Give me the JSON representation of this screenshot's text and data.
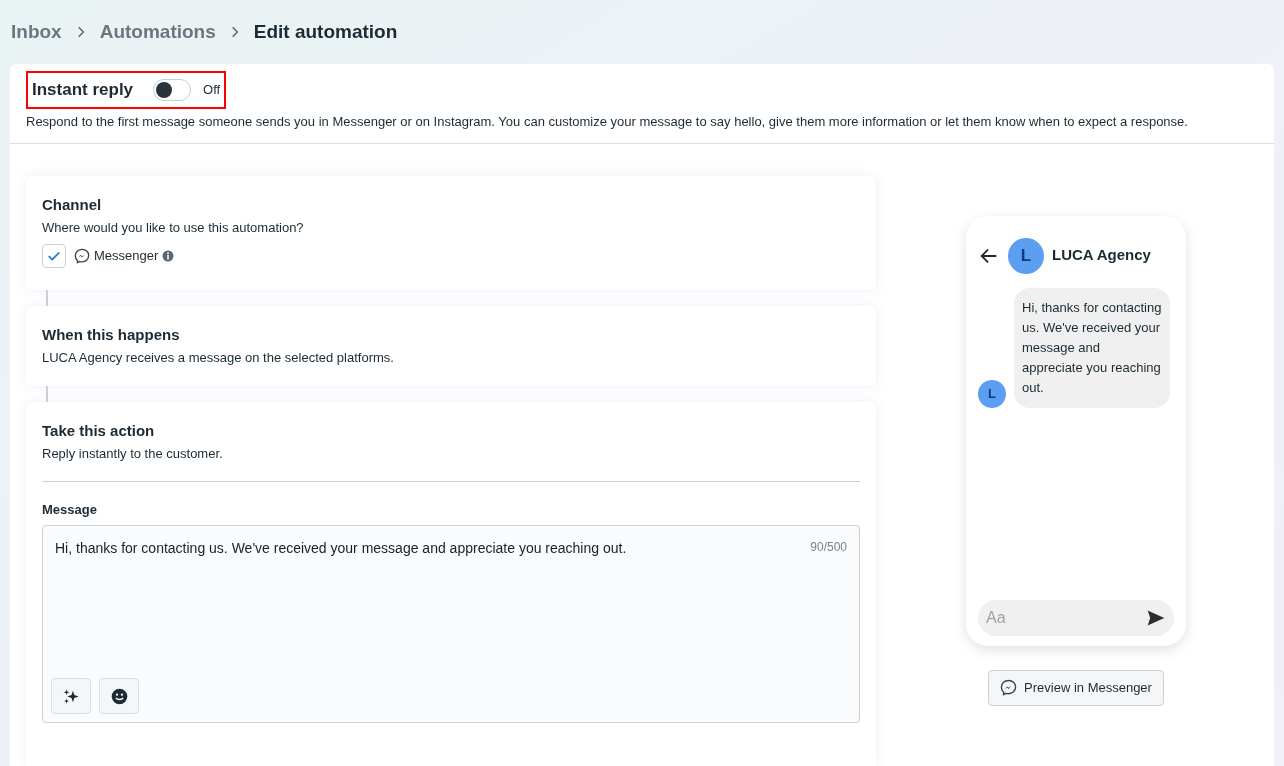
{
  "breadcrumb": [
    {
      "label": "Inbox",
      "current": false
    },
    {
      "label": "Automations",
      "current": false
    },
    {
      "label": "Edit automation",
      "current": true
    }
  ],
  "header": {
    "title": "Instant reply",
    "toggle": {
      "on": false,
      "label": "Off"
    },
    "highlighted": true,
    "description": "Respond to the first message someone sends you in Messenger or on Instagram. You can customize your message to say hello, give them more information or let them know when to expect a response."
  },
  "channel": {
    "title": "Channel",
    "subtitle": "Where would you like to use this automation?",
    "option": {
      "label": "Messenger",
      "checked": true
    }
  },
  "trigger": {
    "title": "When this happens",
    "subtitle": "LUCA Agency receives a message on the selected platforms."
  },
  "action": {
    "title": "Take this action",
    "subtitle": "Reply instantly to the customer.",
    "message_label": "Message",
    "message": "Hi, thanks for contacting us. We've received your message and appreciate you reaching out.",
    "counter": "90/500"
  },
  "preview": {
    "avatar": "L",
    "name": "LUCA Agency",
    "bubble": "Hi, thanks for contacting us. We've received your message and appreciate you reaching out.",
    "bubble_avatar": "L",
    "placeholder": "Aa",
    "button": "Preview in Messenger"
  }
}
